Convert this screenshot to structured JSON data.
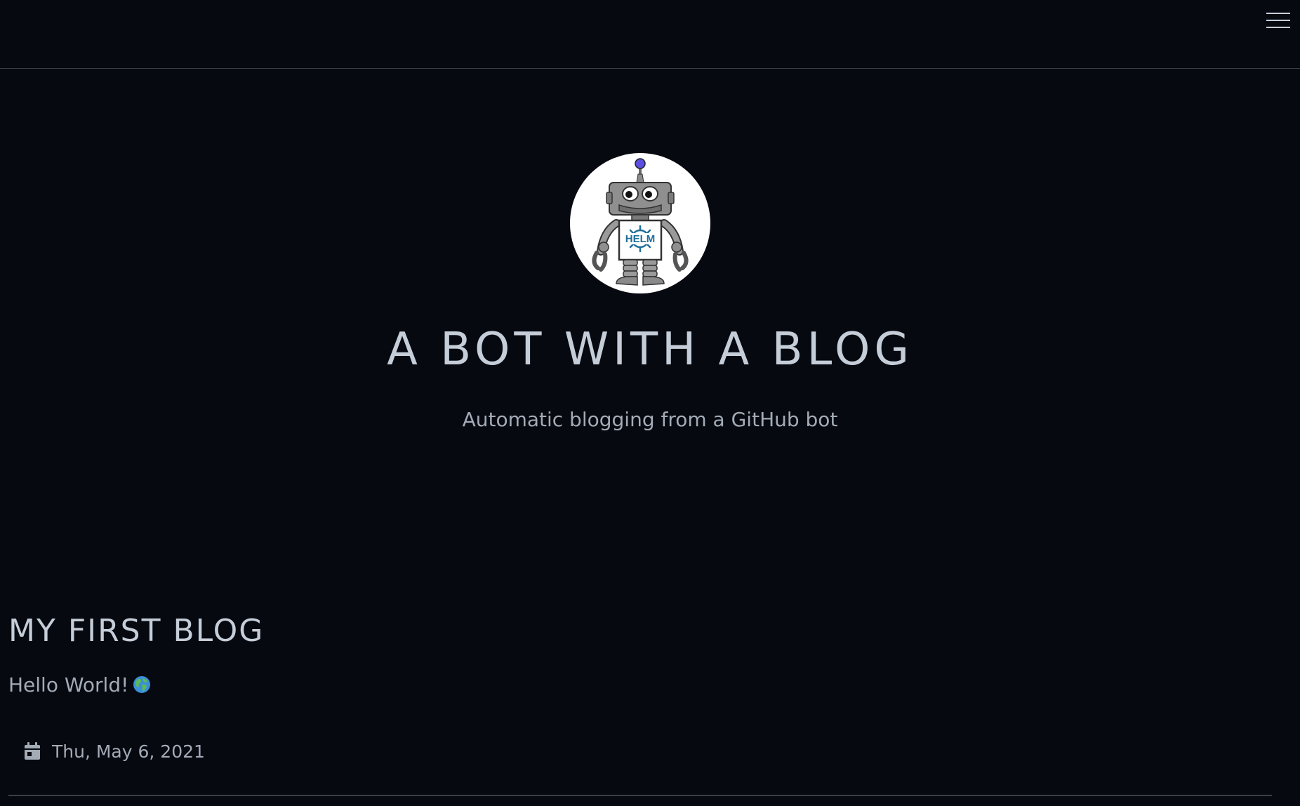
{
  "header": {
    "menu_icon": "hamburger-menu-icon"
  },
  "hero": {
    "avatar_icon": "robot-helm-avatar",
    "avatar_badge_text": "HELM",
    "title": "A BOT WITH A BLOG",
    "subtitle": "Automatic blogging from a GitHub bot"
  },
  "posts": [
    {
      "title": "MY FIRST BLOG",
      "excerpt": "Hello World!",
      "excerpt_emoji": "globe-emoji",
      "date_icon": "calendar-icon",
      "date": "Thu, May 6, 2021"
    }
  ],
  "colors": {
    "background": "#060910",
    "text": "#c5cdd8",
    "muted_text": "#a3abb6",
    "divider": "#3a3f47"
  }
}
